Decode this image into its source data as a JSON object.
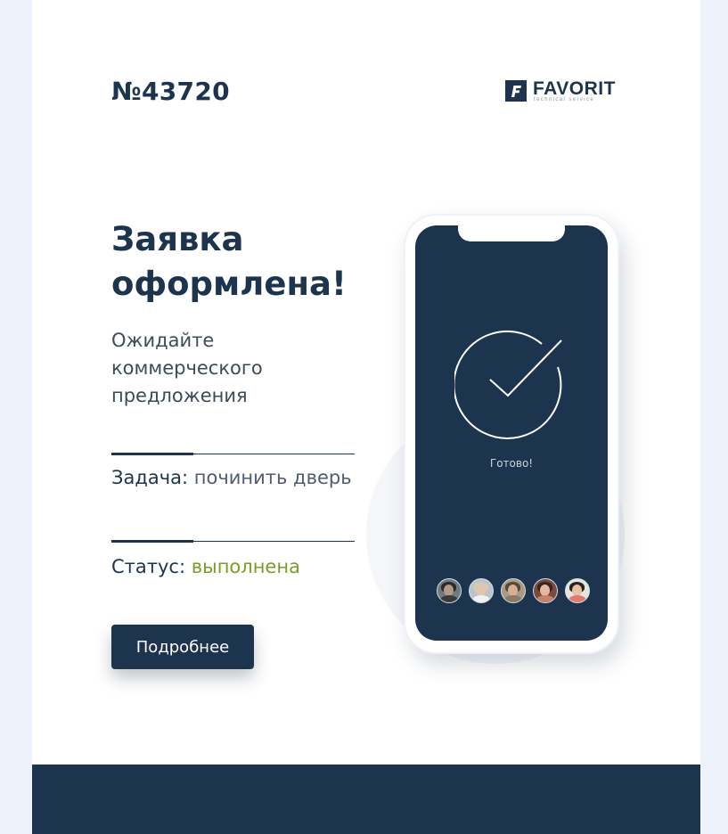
{
  "order": {
    "number": "№43720"
  },
  "logo": {
    "mark": "F",
    "name": "FAVORIT",
    "tagline": "technical service"
  },
  "headline": "Заявка оформлена!",
  "subtitle": "Ожидайте коммерческого предложения",
  "task": {
    "label": "Задача:",
    "value": "починить дверь"
  },
  "status": {
    "label": "Статус:",
    "value": "выполнена"
  },
  "details_button": "Подробнее",
  "phone": {
    "ready_label": "Готово!",
    "icon": "checkmark-circle-icon",
    "avatar_count": 5
  },
  "colors": {
    "primary": "#1c344d",
    "status_done": "#7a9e2b",
    "page_bg": "#eef3fb",
    "card_bg": "#ffffff"
  }
}
